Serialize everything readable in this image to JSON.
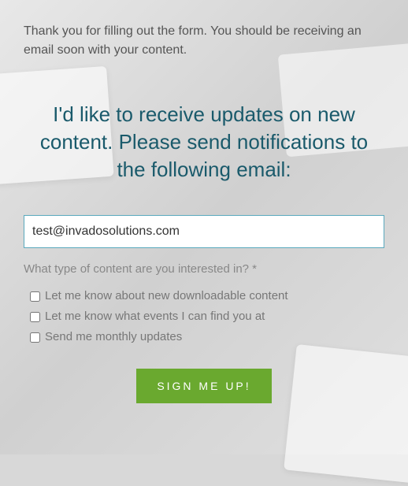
{
  "thank_you_text": "Thank you for filling out the form. You should be receiving an email soon with your content.",
  "headline": "I'd like to receive updates on new content. Please send notifications to the following email:",
  "email_value": "test@invadosolutions.com",
  "question_label": "What type of content are you interested in? *",
  "options": [
    {
      "label": "Let me know about new downloadable content"
    },
    {
      "label": "Let me know what events I can find you at"
    },
    {
      "label": "Send me monthly updates"
    }
  ],
  "submit_label": "SIGN ME UP!"
}
